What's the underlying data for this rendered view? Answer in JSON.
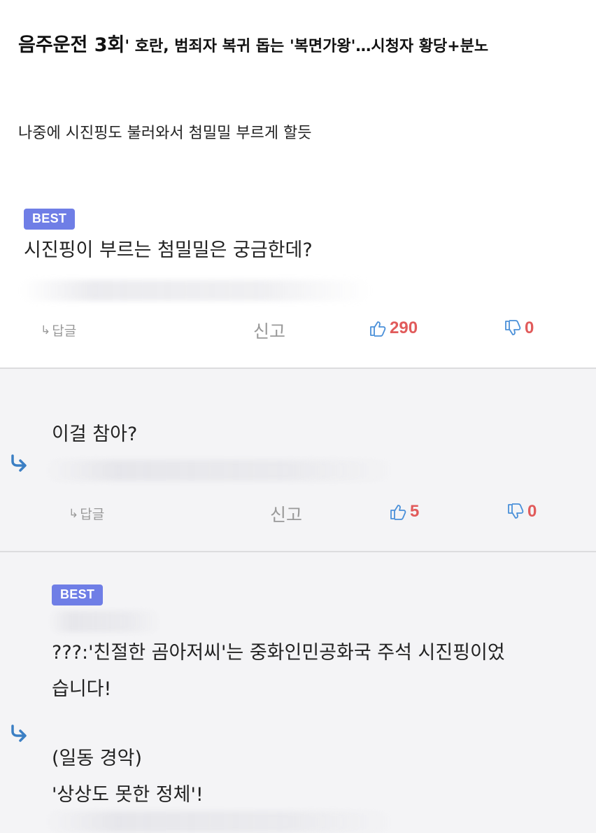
{
  "article": {
    "headline_big": "음주운전 3회",
    "headline_rest": "' 호란, 범죄자 복귀 돕는 '복면가왕'…시청자 황당+분노",
    "summary": "나중에 시진핑도 불러와서 첨밀밀 부르게 할듯"
  },
  "comments": [
    {
      "badge": "BEST",
      "text": "시진핑이 부르는 첨밀밀은 궁금한데?",
      "reply_label": "답글",
      "report_label": "신고",
      "likes": "290",
      "dislikes": "0"
    },
    {
      "text": "이걸 참아?",
      "reply_label": "답글",
      "report_label": "신고",
      "likes": "5",
      "dislikes": "0"
    },
    {
      "badge": "BEST",
      "line1": "???:'친절한 곰아저씨'는 중화인민공화국 주석 시진핑이었",
      "line2": "습니다!",
      "line3": "(일동 경악)",
      "line4": "'상상도 못한 정체'!"
    }
  ],
  "colors": {
    "badge": "#6f7ee6",
    "vote": "#e15b5b",
    "reply_arrow": "#3b7fc4",
    "reply_bg": "#f4f4f6"
  }
}
